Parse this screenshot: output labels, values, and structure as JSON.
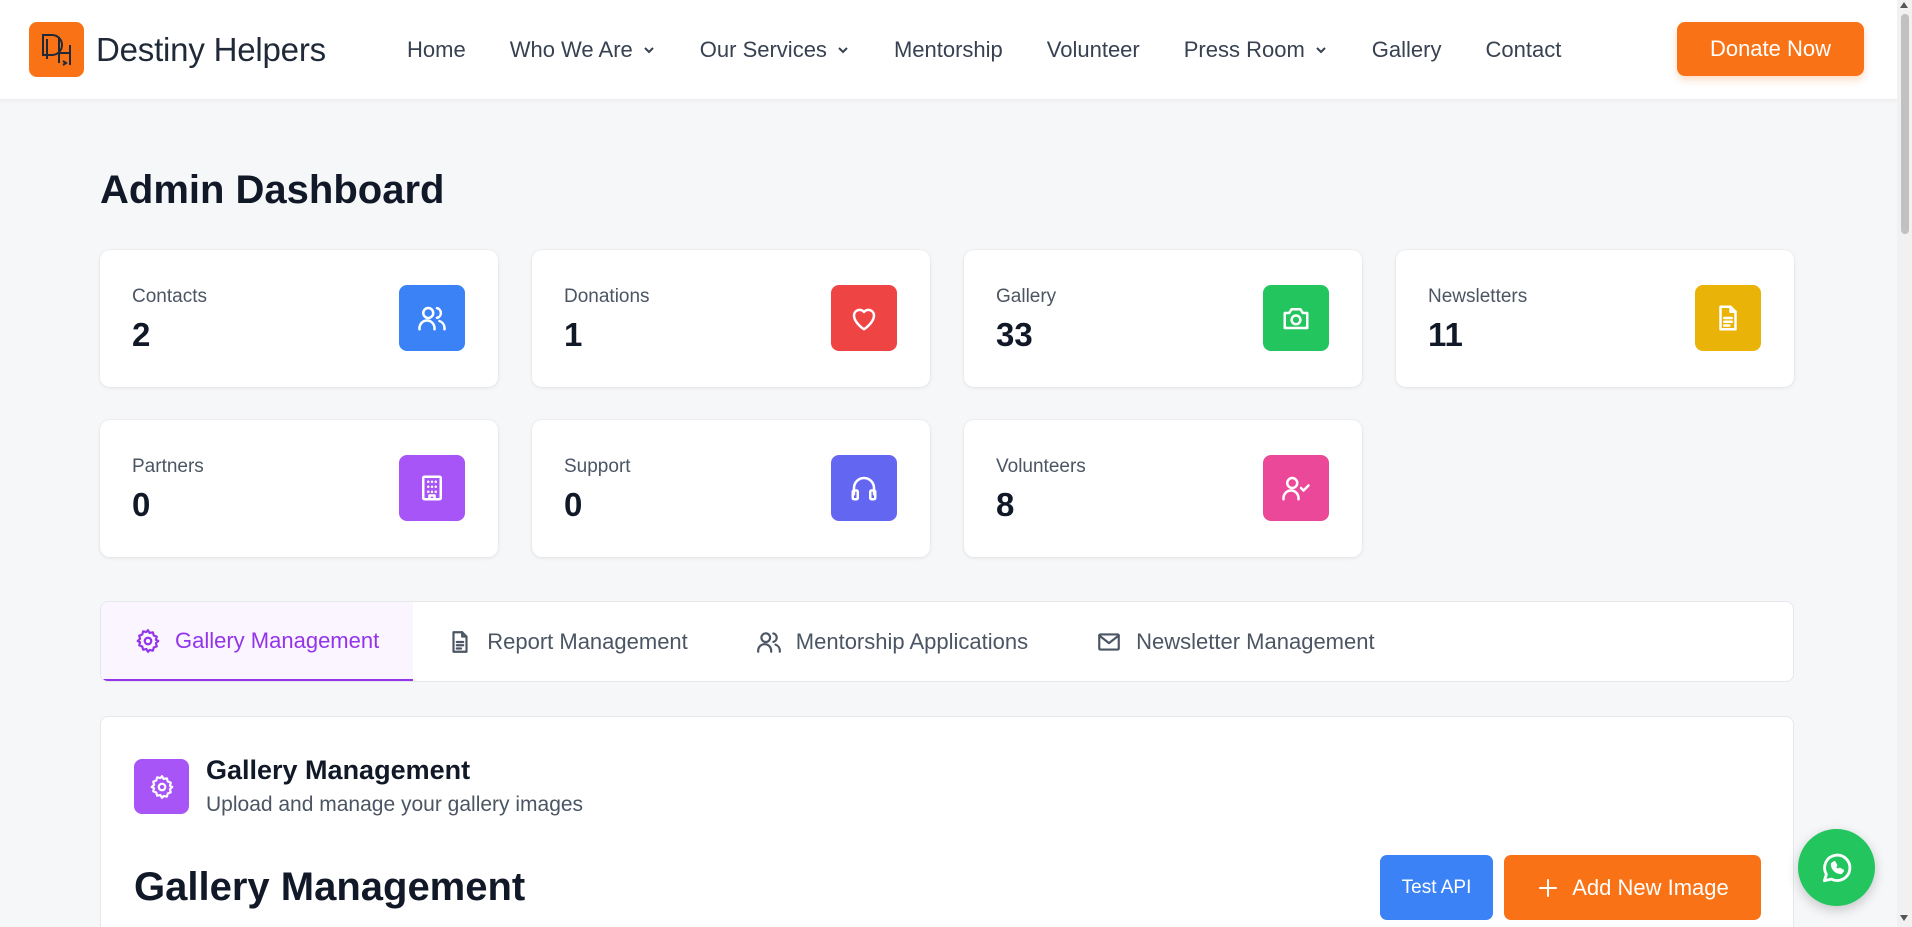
{
  "header": {
    "brand_name": "Destiny Helpers",
    "nav": [
      {
        "label": "Home",
        "dropdown": false
      },
      {
        "label": "Who We Are",
        "dropdown": true
      },
      {
        "label": "Our Services",
        "dropdown": true
      },
      {
        "label": "Mentorship",
        "dropdown": false
      },
      {
        "label": "Volunteer",
        "dropdown": false
      },
      {
        "label": "Press Room",
        "dropdown": true
      },
      {
        "label": "Gallery",
        "dropdown": false
      },
      {
        "label": "Contact",
        "dropdown": false
      }
    ],
    "donate_label": "Donate Now"
  },
  "dashboard": {
    "title": "Admin Dashboard",
    "stats": [
      {
        "label": "Contacts",
        "value": "2",
        "icon": "users-icon",
        "color": "#3b82f6"
      },
      {
        "label": "Donations",
        "value": "1",
        "icon": "heart-icon",
        "color": "#ef4444"
      },
      {
        "label": "Gallery",
        "value": "33",
        "icon": "camera-icon",
        "color": "#22c55e"
      },
      {
        "label": "Newsletters",
        "value": "11",
        "icon": "document-icon",
        "color": "#eab308"
      },
      {
        "label": "Partners",
        "value": "0",
        "icon": "building-icon",
        "color": "#a855f7"
      },
      {
        "label": "Support",
        "value": "0",
        "icon": "headphones-icon",
        "color": "#6366f1"
      },
      {
        "label": "Volunteers",
        "value": "8",
        "icon": "user-check-icon",
        "color": "#ec4899"
      }
    ]
  },
  "tabs": [
    {
      "label": "Gallery Management",
      "icon": "gear-icon",
      "active": true
    },
    {
      "label": "Report Management",
      "icon": "document-icon",
      "active": false
    },
    {
      "label": "Mentorship Applications",
      "icon": "users-icon",
      "active": false
    },
    {
      "label": "Newsletter Management",
      "icon": "mail-icon",
      "active": false
    }
  ],
  "panel": {
    "title": "Gallery Management",
    "subtitle": "Upload and manage your gallery images",
    "section_title": "Gallery Management",
    "test_api_label": "Test API",
    "add_image_label": "Add New Image"
  },
  "colors": {
    "accent": "#f97316",
    "active_tab": "#9333ea",
    "whatsapp": "#22c55e"
  }
}
